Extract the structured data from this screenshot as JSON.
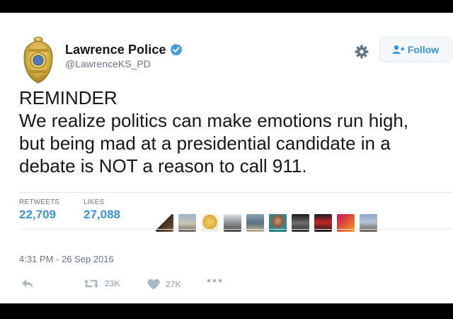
{
  "account": {
    "display_name": "Lawrence Police",
    "handle": "@LawrenceKS_PD",
    "verified": true,
    "avatar": "police-badge"
  },
  "header": {
    "follow_label": "Follow",
    "settings_icon": "gear-icon",
    "follow_icon": "add-user-icon"
  },
  "tweet": {
    "lines": [
      "REMINDER",
      "We realize politics can make emotions run high,",
      "but being mad at a presidential candidate in a",
      "debate is NOT a reason to call 911."
    ]
  },
  "stats": {
    "retweets_label": "RETWEETS",
    "retweets_value": "22,709",
    "likes_label": "LIKES",
    "likes_value": "27,088"
  },
  "likers": {
    "count_shown": 9
  },
  "meta": {
    "timestamp": "4:31 PM - 26 Sep 2016"
  },
  "actions": {
    "reply_icon": "reply-icon",
    "retweet_icon": "retweet-icon",
    "retweet_count": "23K",
    "like_icon": "heart-icon",
    "like_count": "27K",
    "more_icon": "more-icon"
  },
  "colors": {
    "accent": "#3b94d9",
    "text": "#14171a",
    "muted": "#657786",
    "icon_muted": "#aab8c2"
  }
}
